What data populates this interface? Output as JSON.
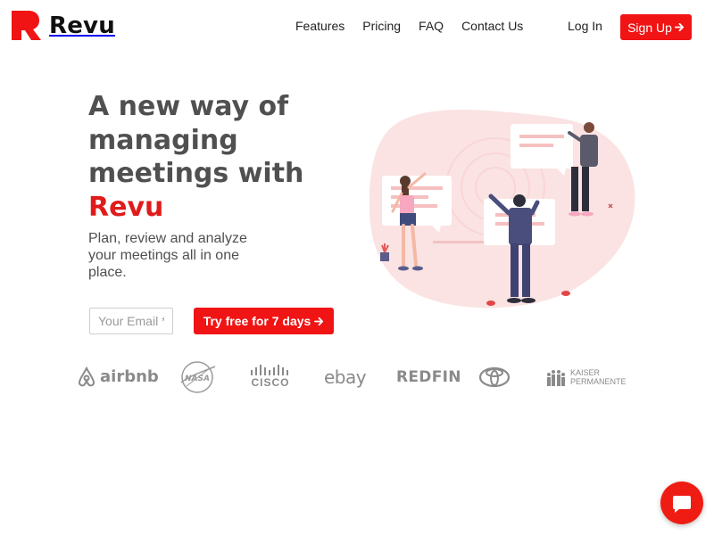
{
  "header": {
    "brand": "Revu",
    "nav": [
      "Features",
      "Pricing",
      "FAQ",
      "Contact Us"
    ],
    "login": "Log In",
    "signup": "Sign Up"
  },
  "hero": {
    "title_lead": "A new way of managing meetings with ",
    "title_brand": "Revu",
    "subtitle": "Plan, review and analyze your meetings all in one place.",
    "email_placeholder": "Your Email *",
    "cta": "Try free for 7 days"
  },
  "partners": {
    "airbnb": "airbnb",
    "nasa": "NASA",
    "cisco": "CISCO",
    "ebay": "ebay",
    "redfin": "REDFIN",
    "kaiser_1": "KAISER",
    "kaiser_2": "PERMANENTE"
  },
  "icons": {
    "arrow": "arrow-right-icon",
    "chat": "chat-bubble-icon"
  },
  "colors": {
    "accent": "#f01414",
    "text": "#505050",
    "illustration_bg": "#fbe3e3",
    "logo_gray": "#8a8a8a"
  }
}
